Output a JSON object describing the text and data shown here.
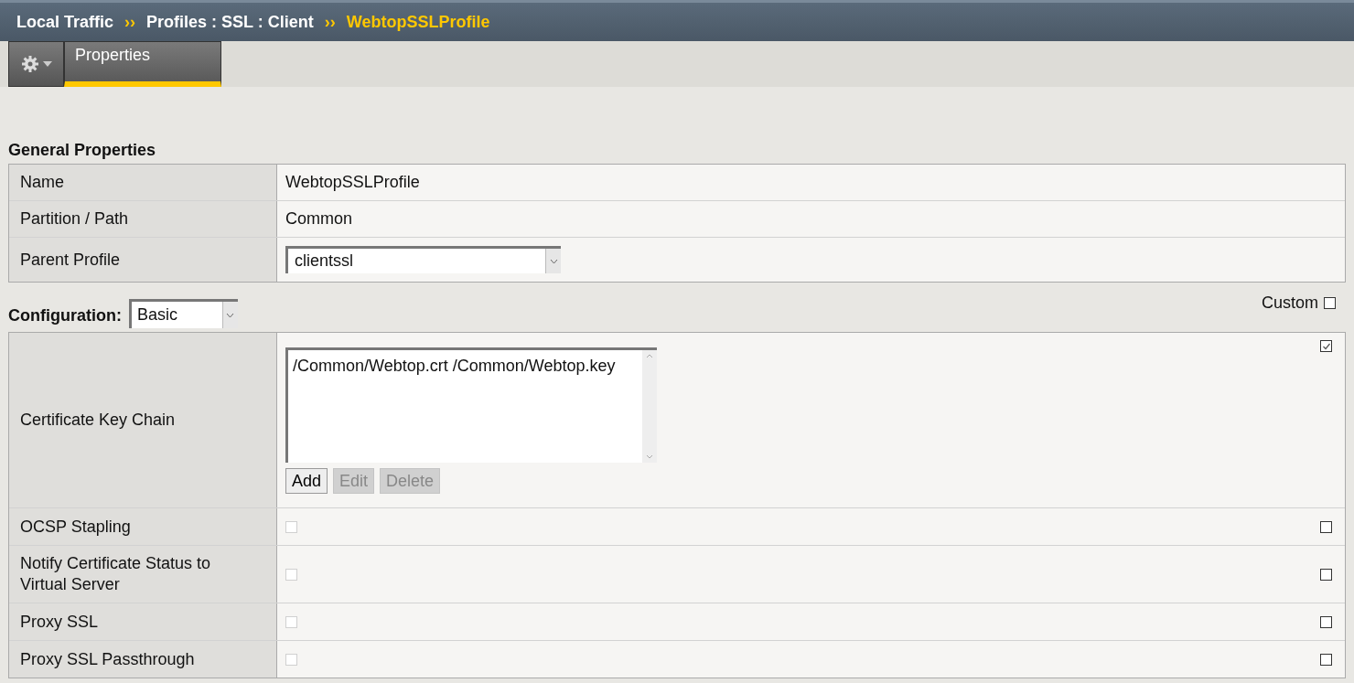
{
  "breadcrumb": {
    "items": [
      "Local Traffic",
      "Profiles : SSL : Client"
    ],
    "current": "WebtopSSLProfile",
    "separators": [
      "››",
      "››"
    ]
  },
  "tabs": [
    {
      "label": "Properties",
      "selected": true
    }
  ],
  "general": {
    "title": "General Properties",
    "rows": [
      {
        "kind": "text",
        "label": "Name",
        "value": "WebtopSSLProfile"
      },
      {
        "kind": "text",
        "label": "Partition / Path",
        "value": "Common"
      },
      {
        "kind": "select",
        "label": "Parent Profile",
        "value": "clientssl"
      }
    ]
  },
  "configuration": {
    "label": "Configuration:",
    "value": "Basic",
    "custom_label": "Custom",
    "custom_checked": false,
    "rows": [
      {
        "kind": "listbox",
        "label": "Certificate Key Chain",
        "items": [
          "/Common/Webtop.crt /Common/Webtop.key"
        ],
        "buttons": [
          {
            "label": "Add",
            "disabled": false
          },
          {
            "label": "Edit",
            "disabled": true
          },
          {
            "label": "Delete",
            "disabled": true
          }
        ],
        "custom": true
      },
      {
        "kind": "checkbox",
        "label": "OCSP Stapling",
        "checked": false,
        "disabled": true,
        "custom": false
      },
      {
        "kind": "checkbox",
        "label": "Notify Certificate Status to Virtual Server",
        "checked": false,
        "disabled": true,
        "custom": false
      },
      {
        "kind": "checkbox",
        "label": "Proxy SSL",
        "checked": false,
        "disabled": true,
        "custom": false
      },
      {
        "kind": "checkbox",
        "label": "Proxy SSL Passthrough",
        "checked": false,
        "disabled": true,
        "custom": false
      }
    ]
  }
}
